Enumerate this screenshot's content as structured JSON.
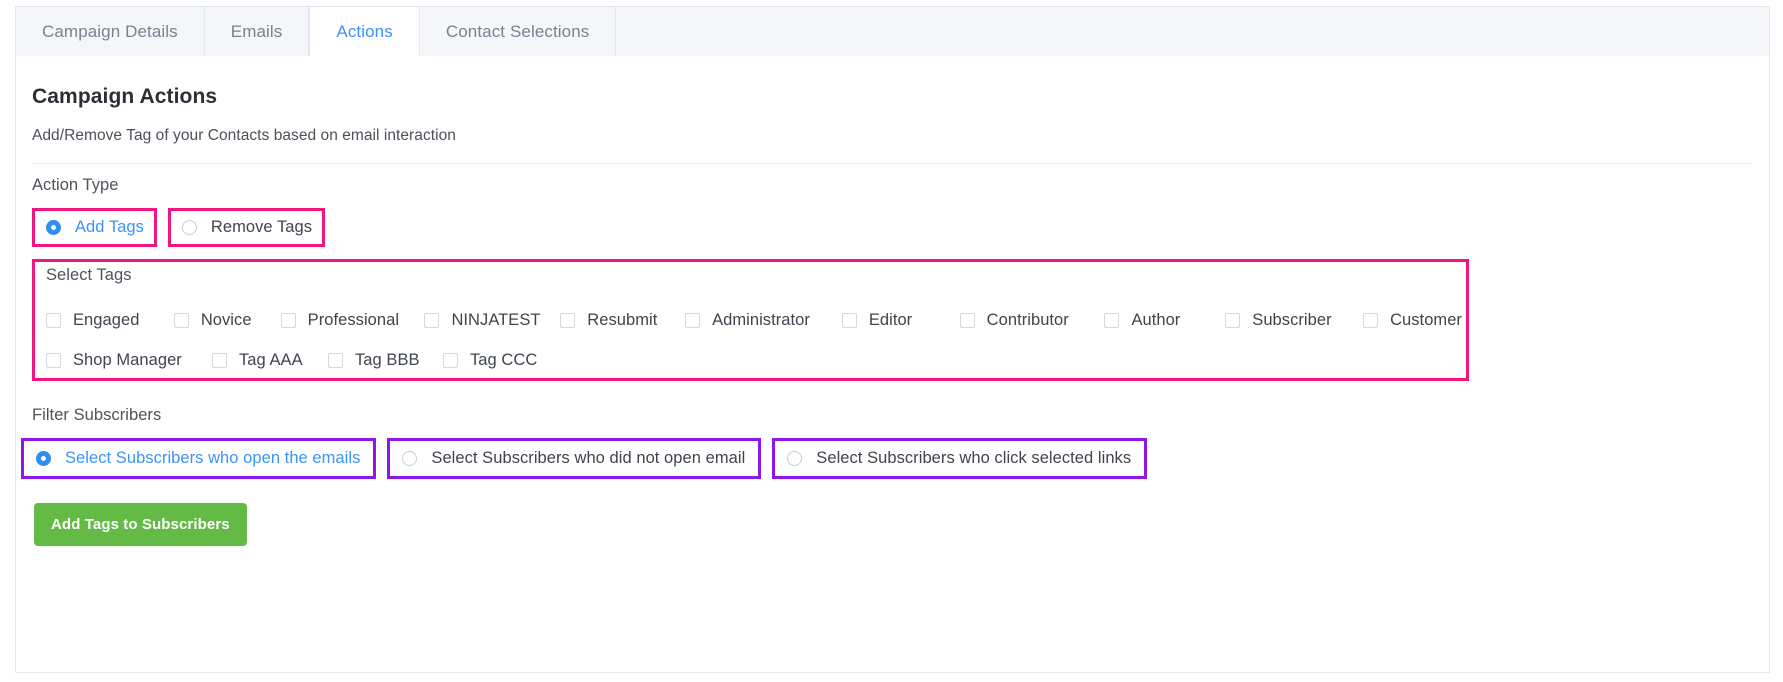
{
  "tabs": [
    {
      "label": "Campaign Details",
      "active": false
    },
    {
      "label": "Emails",
      "active": false
    },
    {
      "label": "Actions",
      "active": true
    },
    {
      "label": "Contact Selections",
      "active": false
    }
  ],
  "content": {
    "heading": "Campaign Actions",
    "subheading": "Add/Remove Tag of your Contacts based on email interaction"
  },
  "action_type": {
    "label": "Action Type",
    "options": [
      {
        "label": "Add Tags",
        "selected": true
      },
      {
        "label": "Remove Tags",
        "selected": false
      }
    ]
  },
  "select_tags": {
    "label": "Select Tags",
    "row1": [
      {
        "label": "Engaged",
        "checked": false
      },
      {
        "label": "Novice",
        "checked": false
      },
      {
        "label": "Professional",
        "checked": false
      },
      {
        "label": "NINJATEST",
        "checked": false
      },
      {
        "label": "Resubmit",
        "checked": false
      },
      {
        "label": "Administrator",
        "checked": false
      },
      {
        "label": "Editor",
        "checked": false
      },
      {
        "label": "Contributor",
        "checked": false
      },
      {
        "label": "Author",
        "checked": false
      },
      {
        "label": "Subscriber",
        "checked": false
      },
      {
        "label": "Customer",
        "checked": false
      }
    ],
    "row2": [
      {
        "label": "Shop Manager",
        "checked": false
      },
      {
        "label": "Tag AAA",
        "checked": false
      },
      {
        "label": "Tag BBB",
        "checked": false
      },
      {
        "label": "Tag CCC",
        "checked": false
      }
    ]
  },
  "filter_subscribers": {
    "label": "Filter Subscribers",
    "options": [
      {
        "label": "Select Subscribers who open the emails",
        "selected": true
      },
      {
        "label": "Select Subscribers who did not open email",
        "selected": false
      },
      {
        "label": "Select Subscribers who click selected links",
        "selected": false
      }
    ]
  },
  "submit": {
    "label": "Add Tags to Subscribers"
  },
  "colors": {
    "accent_blue": "#3c93f7",
    "annotation_pink": "#f2147f",
    "annotation_purple": "#8f18e8",
    "button_green": "#63bb46",
    "tab_bg": "#f4f6f9",
    "border": "#e3e7ee"
  }
}
